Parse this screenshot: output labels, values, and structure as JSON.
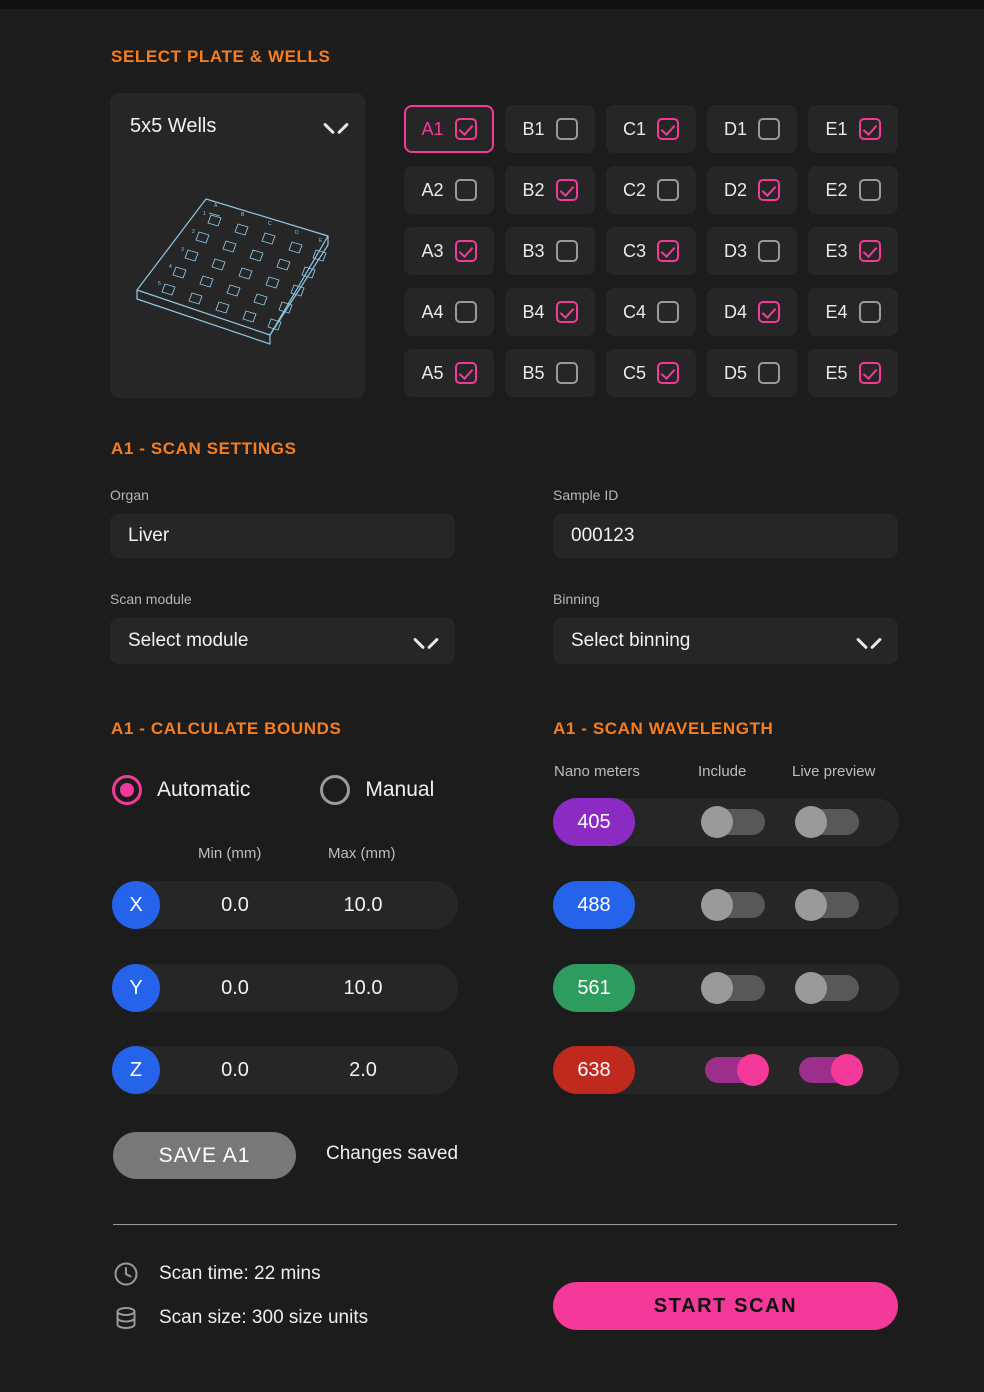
{
  "colors": {
    "accent_orange": "#F57E20",
    "accent_pink": "#F4399A",
    "axis_blue": "#2563EB",
    "panel": "#262626",
    "background": "#1c1c1c",
    "toggle_on_track": "#9C2F8C",
    "toggle_off_track": "#585858"
  },
  "plate_section": {
    "title": "Select Plate & Wells",
    "plate_dropdown": {
      "value": "5x5 Wells",
      "icon": "chevron-down-icon"
    },
    "plate_preview_icon": "isometric-well-plate-icon",
    "wells": [
      {
        "id": "A1",
        "checked": true,
        "selected": true
      },
      {
        "id": "B1",
        "checked": false,
        "selected": false
      },
      {
        "id": "C1",
        "checked": true,
        "selected": false
      },
      {
        "id": "D1",
        "checked": false,
        "selected": false
      },
      {
        "id": "E1",
        "checked": true,
        "selected": false
      },
      {
        "id": "A2",
        "checked": false,
        "selected": false
      },
      {
        "id": "B2",
        "checked": true,
        "selected": false
      },
      {
        "id": "C2",
        "checked": false,
        "selected": false
      },
      {
        "id": "D2",
        "checked": true,
        "selected": false
      },
      {
        "id": "E2",
        "checked": false,
        "selected": false
      },
      {
        "id": "A3",
        "checked": true,
        "selected": false
      },
      {
        "id": "B3",
        "checked": false,
        "selected": false
      },
      {
        "id": "C3",
        "checked": true,
        "selected": false
      },
      {
        "id": "D3",
        "checked": false,
        "selected": false
      },
      {
        "id": "E3",
        "checked": true,
        "selected": false
      },
      {
        "id": "A4",
        "checked": false,
        "selected": false
      },
      {
        "id": "B4",
        "checked": true,
        "selected": false
      },
      {
        "id": "C4",
        "checked": false,
        "selected": false
      },
      {
        "id": "D4",
        "checked": true,
        "selected": false
      },
      {
        "id": "E4",
        "checked": false,
        "selected": false
      },
      {
        "id": "A5",
        "checked": true,
        "selected": false
      },
      {
        "id": "B5",
        "checked": false,
        "selected": false
      },
      {
        "id": "C5",
        "checked": true,
        "selected": false
      },
      {
        "id": "D5",
        "checked": false,
        "selected": false
      },
      {
        "id": "E5",
        "checked": true,
        "selected": false
      }
    ]
  },
  "scan_settings": {
    "title": "A1 - Scan Settings",
    "organ": {
      "label": "Organ",
      "value": "Liver",
      "placeholder": "Organ"
    },
    "sample_id": {
      "label": "Sample ID",
      "value": "000123",
      "placeholder": "Sample ID"
    },
    "scan_module": {
      "label": "Scan module",
      "value": "Select module",
      "icon": "chevron-down-icon"
    },
    "binning": {
      "label": "Binning",
      "value": "Select binning",
      "icon": "chevron-down-icon"
    }
  },
  "bounds": {
    "title": "A1 - Calculate Bounds",
    "modes": [
      {
        "label": "Automatic",
        "selected": true
      },
      {
        "label": "Manual",
        "selected": false
      }
    ],
    "col_min": "Min (mm)",
    "col_max": "Max (mm)",
    "axes": [
      {
        "axis": "X",
        "min": "0.0",
        "max": "10.0"
      },
      {
        "axis": "Y",
        "min": "0.0",
        "max": "10.0"
      },
      {
        "axis": "Z",
        "min": "0.0",
        "max": "2.0"
      }
    ]
  },
  "wavelength": {
    "title": "A1 - Scan Wavelength",
    "col_nm": "Nano meters",
    "col_include": "Include",
    "col_preview": "Live preview",
    "rows": [
      {
        "nm": "405",
        "color": "#8B2BC4",
        "include": false,
        "live_preview": false
      },
      {
        "nm": "488",
        "color": "#2563EB",
        "include": false,
        "live_preview": false
      },
      {
        "nm": "561",
        "color": "#2E9B5F",
        "include": false,
        "live_preview": false
      },
      {
        "nm": "638",
        "color": "#C0291E",
        "include": true,
        "live_preview": true
      }
    ]
  },
  "footer": {
    "save_label": "SAVE A1",
    "save_status": "Changes saved",
    "scan_time": "Scan time: 22 mins",
    "scan_time_icon": "clock-icon",
    "scan_size": "Scan size: 300 size units",
    "scan_size_icon": "database-icon",
    "start_label": "START SCAN"
  }
}
